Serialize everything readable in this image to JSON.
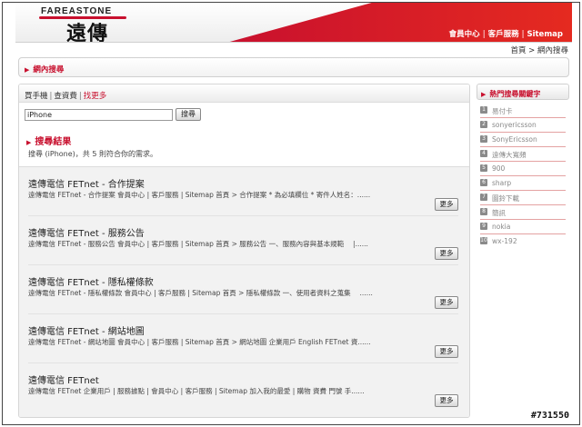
{
  "header": {
    "logo_en": "FAREASTONE",
    "logo_zh": "遠傳",
    "nav": [
      "會員中心",
      "客戶服務",
      "Sitemap"
    ]
  },
  "breadcrumb": "首頁 > 網內搜尋",
  "site_search_title": "網內搜尋",
  "tabs": [
    {
      "label": "買手機",
      "active": false
    },
    {
      "label": "查資費",
      "active": false
    },
    {
      "label": "找更多",
      "active": true
    }
  ],
  "search": {
    "value": "iPhone",
    "button": "搜尋"
  },
  "results_title": "搜尋結果",
  "results_summary": "搜尋 (iPhone)，共 5 則符合你的需求。",
  "results": [
    {
      "title": "遠傳電信 FETnet - 合作提案",
      "snippet": "遠傳電信 FETnet - 合作提案 會員中心 | 客戶服務 | Sitemap 首頁 > 合作提案 * 為必填欄位 * 寄件人姓名：......",
      "more": "更多"
    },
    {
      "title": "遠傳電信 FETnet - 服務公告",
      "snippet": "遠傳電信 FETnet - 服務公告 會員中心 | 客戶服務 | Sitemap 首頁 > 服務公告 一、服務內容與基本規範　 |......",
      "more": "更多"
    },
    {
      "title": "遠傳電信 FETnet - 隱私權條款",
      "snippet": "遠傳電信 FETnet - 隱私權條款 會員中心 | 客戶服務 | Sitemap 首頁 > 隱私權條款 一、使用者資料之蒐集　 ......",
      "more": "更多"
    },
    {
      "title": "遠傳電信 FETnet - 網站地圖",
      "snippet": "遠傳電信 FETnet - 網站地圖 會員中心 | 客戶服務 | Sitemap 首頁 > 網站地圖 企業用戶 English FETnet 資......",
      "more": "更多"
    },
    {
      "title": "遠傳電信 FETnet",
      "snippet": "遠傳電信 FETnet 企業用戶 | 服務據點 | 會員中心 | 客戶服務 | Sitemap 加入我的最愛 | 購物 資費 門號 手......",
      "more": "更多"
    }
  ],
  "hot_keywords_title": "熱門搜尋關鍵字",
  "hot_keywords": [
    {
      "num": "1",
      "label": "易付卡"
    },
    {
      "num": "2",
      "label": "sonyericsson"
    },
    {
      "num": "3",
      "label": "SonyEricsson"
    },
    {
      "num": "4",
      "label": "遠傳大寬頻"
    },
    {
      "num": "5",
      "label": "900"
    },
    {
      "num": "6",
      "label": "sharp"
    },
    {
      "num": "7",
      "label": "圖鈴下載"
    },
    {
      "num": "8",
      "label": "簡訊"
    },
    {
      "num": "9",
      "label": "nokia"
    },
    {
      "num": "10",
      "label": "wx-192"
    }
  ],
  "watermark": "#731550",
  "colors": {
    "brand_red": "#c8102e"
  }
}
